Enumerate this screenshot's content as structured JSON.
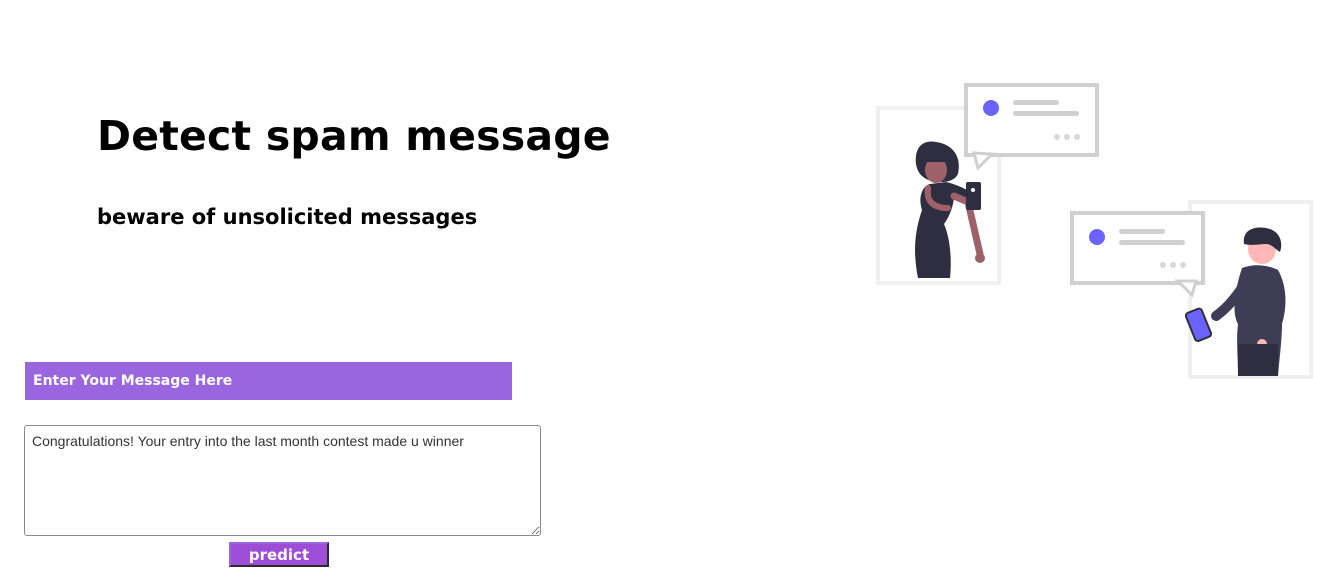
{
  "header": {
    "title": "Detect spam message",
    "subtitle": "beware of unsolicited messages"
  },
  "form": {
    "input_label": "Enter Your Message Here",
    "message_value": "Congratulations! Your entry into the last month contest made u winner",
    "predict_label": "predict"
  },
  "colors": {
    "accent": "#9966e0",
    "button": "#9c4fd6",
    "illustration_accent": "#6c63ff",
    "text": "#000000"
  },
  "illustration": {
    "name": "chatting-people-illustration"
  }
}
